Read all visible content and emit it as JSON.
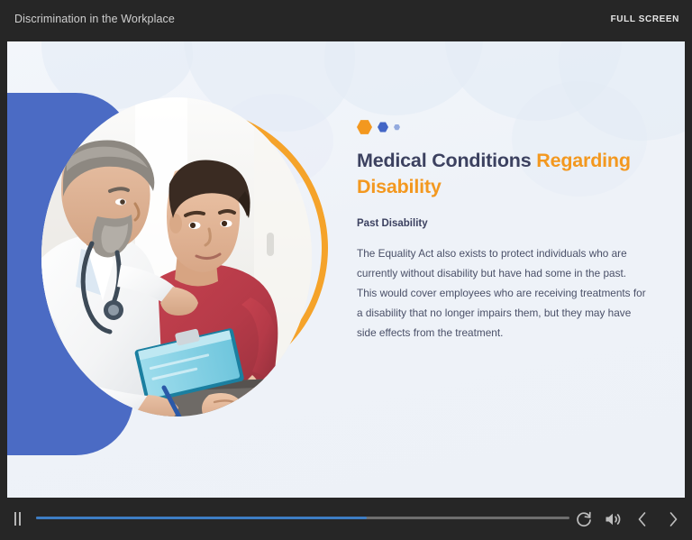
{
  "topbar": {
    "course_title": "Discrimination in the Workplace",
    "fullscreen_label": "FULL SCREEN"
  },
  "slide": {
    "heading_main": "Medical Conditions ",
    "heading_accent": "Regarding Disability",
    "subheading": "Past Disability",
    "body": "The Equality Act also exists to protect individuals who are currently without disability but have had some in the past. This would cover employees who are receiving treatments for a disability that no longer impairs them, but they may have side effects from the treatment.",
    "image_alt": "doctor in white coat with stethoscope holding a blue clipboard placing hand on shoulder of a young man in a red t-shirt",
    "decor": {
      "hexagon_large": "hexagon-orange",
      "hexagon_medium": "hexagon-blue",
      "hexagon_small": "hexagon-light-blue",
      "ring": "orange-ring",
      "panel": "blue-panel"
    }
  },
  "controls": {
    "pause_label": "Pause",
    "replay_label": "Replay",
    "volume_label": "Volume",
    "previous_label": "Previous",
    "next_label": "Next",
    "progress_percent": 62
  },
  "colors": {
    "accent_orange": "#f3981f",
    "accent_blue": "#4b6bc4",
    "heading_navy": "#3c4160",
    "body_text": "#4a5068",
    "chrome_dark": "#262626",
    "slide_bg": "#eef2f8",
    "progress_fill": "#3d7dc4",
    "progress_track": "#6e6e6e"
  }
}
